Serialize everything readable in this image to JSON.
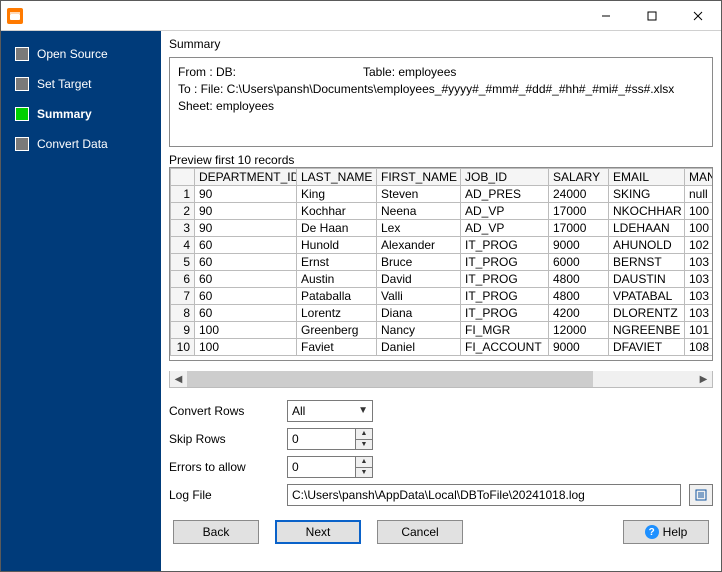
{
  "sidebar": {
    "items": [
      {
        "label": "Open Source",
        "active": false,
        "bold": false
      },
      {
        "label": "Set Target",
        "active": false,
        "bold": false
      },
      {
        "label": "Summary",
        "active": true,
        "bold": true
      },
      {
        "label": "Convert Data",
        "active": false,
        "bold": false
      }
    ]
  },
  "summary": {
    "heading": "Summary",
    "line1": "From : DB:",
    "line1b": "Table: employees",
    "line2": "To : File: C:\\Users\\pansh\\Documents\\employees_#yyyy#_#mm#_#dd#_#hh#_#mi#_#ss#.xlsx Sheet: employees"
  },
  "preview": {
    "heading": "Preview first 10 records",
    "columns": [
      "DEPARTMENT_ID",
      "LAST_NAME",
      "FIRST_NAME",
      "JOB_ID",
      "SALARY",
      "EMAIL",
      "MANAG"
    ],
    "rows": [
      [
        "90",
        "King",
        "Steven",
        "AD_PRES",
        "24000",
        "SKING",
        "null"
      ],
      [
        "90",
        "Kochhar",
        "Neena",
        "AD_VP",
        "17000",
        "NKOCHHAR",
        "100"
      ],
      [
        "90",
        "De Haan",
        "Lex",
        "AD_VP",
        "17000",
        "LDEHAAN",
        "100"
      ],
      [
        "60",
        "Hunold",
        "Alexander",
        "IT_PROG",
        "9000",
        "AHUNOLD",
        "102"
      ],
      [
        "60",
        "Ernst",
        "Bruce",
        "IT_PROG",
        "6000",
        "BERNST",
        "103"
      ],
      [
        "60",
        "Austin",
        "David",
        "IT_PROG",
        "4800",
        "DAUSTIN",
        "103"
      ],
      [
        "60",
        "Pataballa",
        "Valli",
        "IT_PROG",
        "4800",
        "VPATABAL",
        "103"
      ],
      [
        "60",
        "Lorentz",
        "Diana",
        "IT_PROG",
        "4200",
        "DLORENTZ",
        "103"
      ],
      [
        "100",
        "Greenberg",
        "Nancy",
        "FI_MGR",
        "12000",
        "NGREENBE",
        "101"
      ],
      [
        "100",
        "Faviet",
        "Daniel",
        "FI_ACCOUNT",
        "9000",
        "DFAVIET",
        "108"
      ]
    ]
  },
  "form": {
    "convert_rows_label": "Convert Rows",
    "convert_rows_value": "All",
    "skip_rows_label": "Skip Rows",
    "skip_rows_value": "0",
    "errors_label": "Errors to allow",
    "errors_value": "0",
    "log_label": "Log File",
    "log_value": "C:\\Users\\pansh\\AppData\\Local\\DBToFile\\20241018.log"
  },
  "buttons": {
    "back": "Back",
    "next": "Next",
    "cancel": "Cancel",
    "help": "Help"
  }
}
